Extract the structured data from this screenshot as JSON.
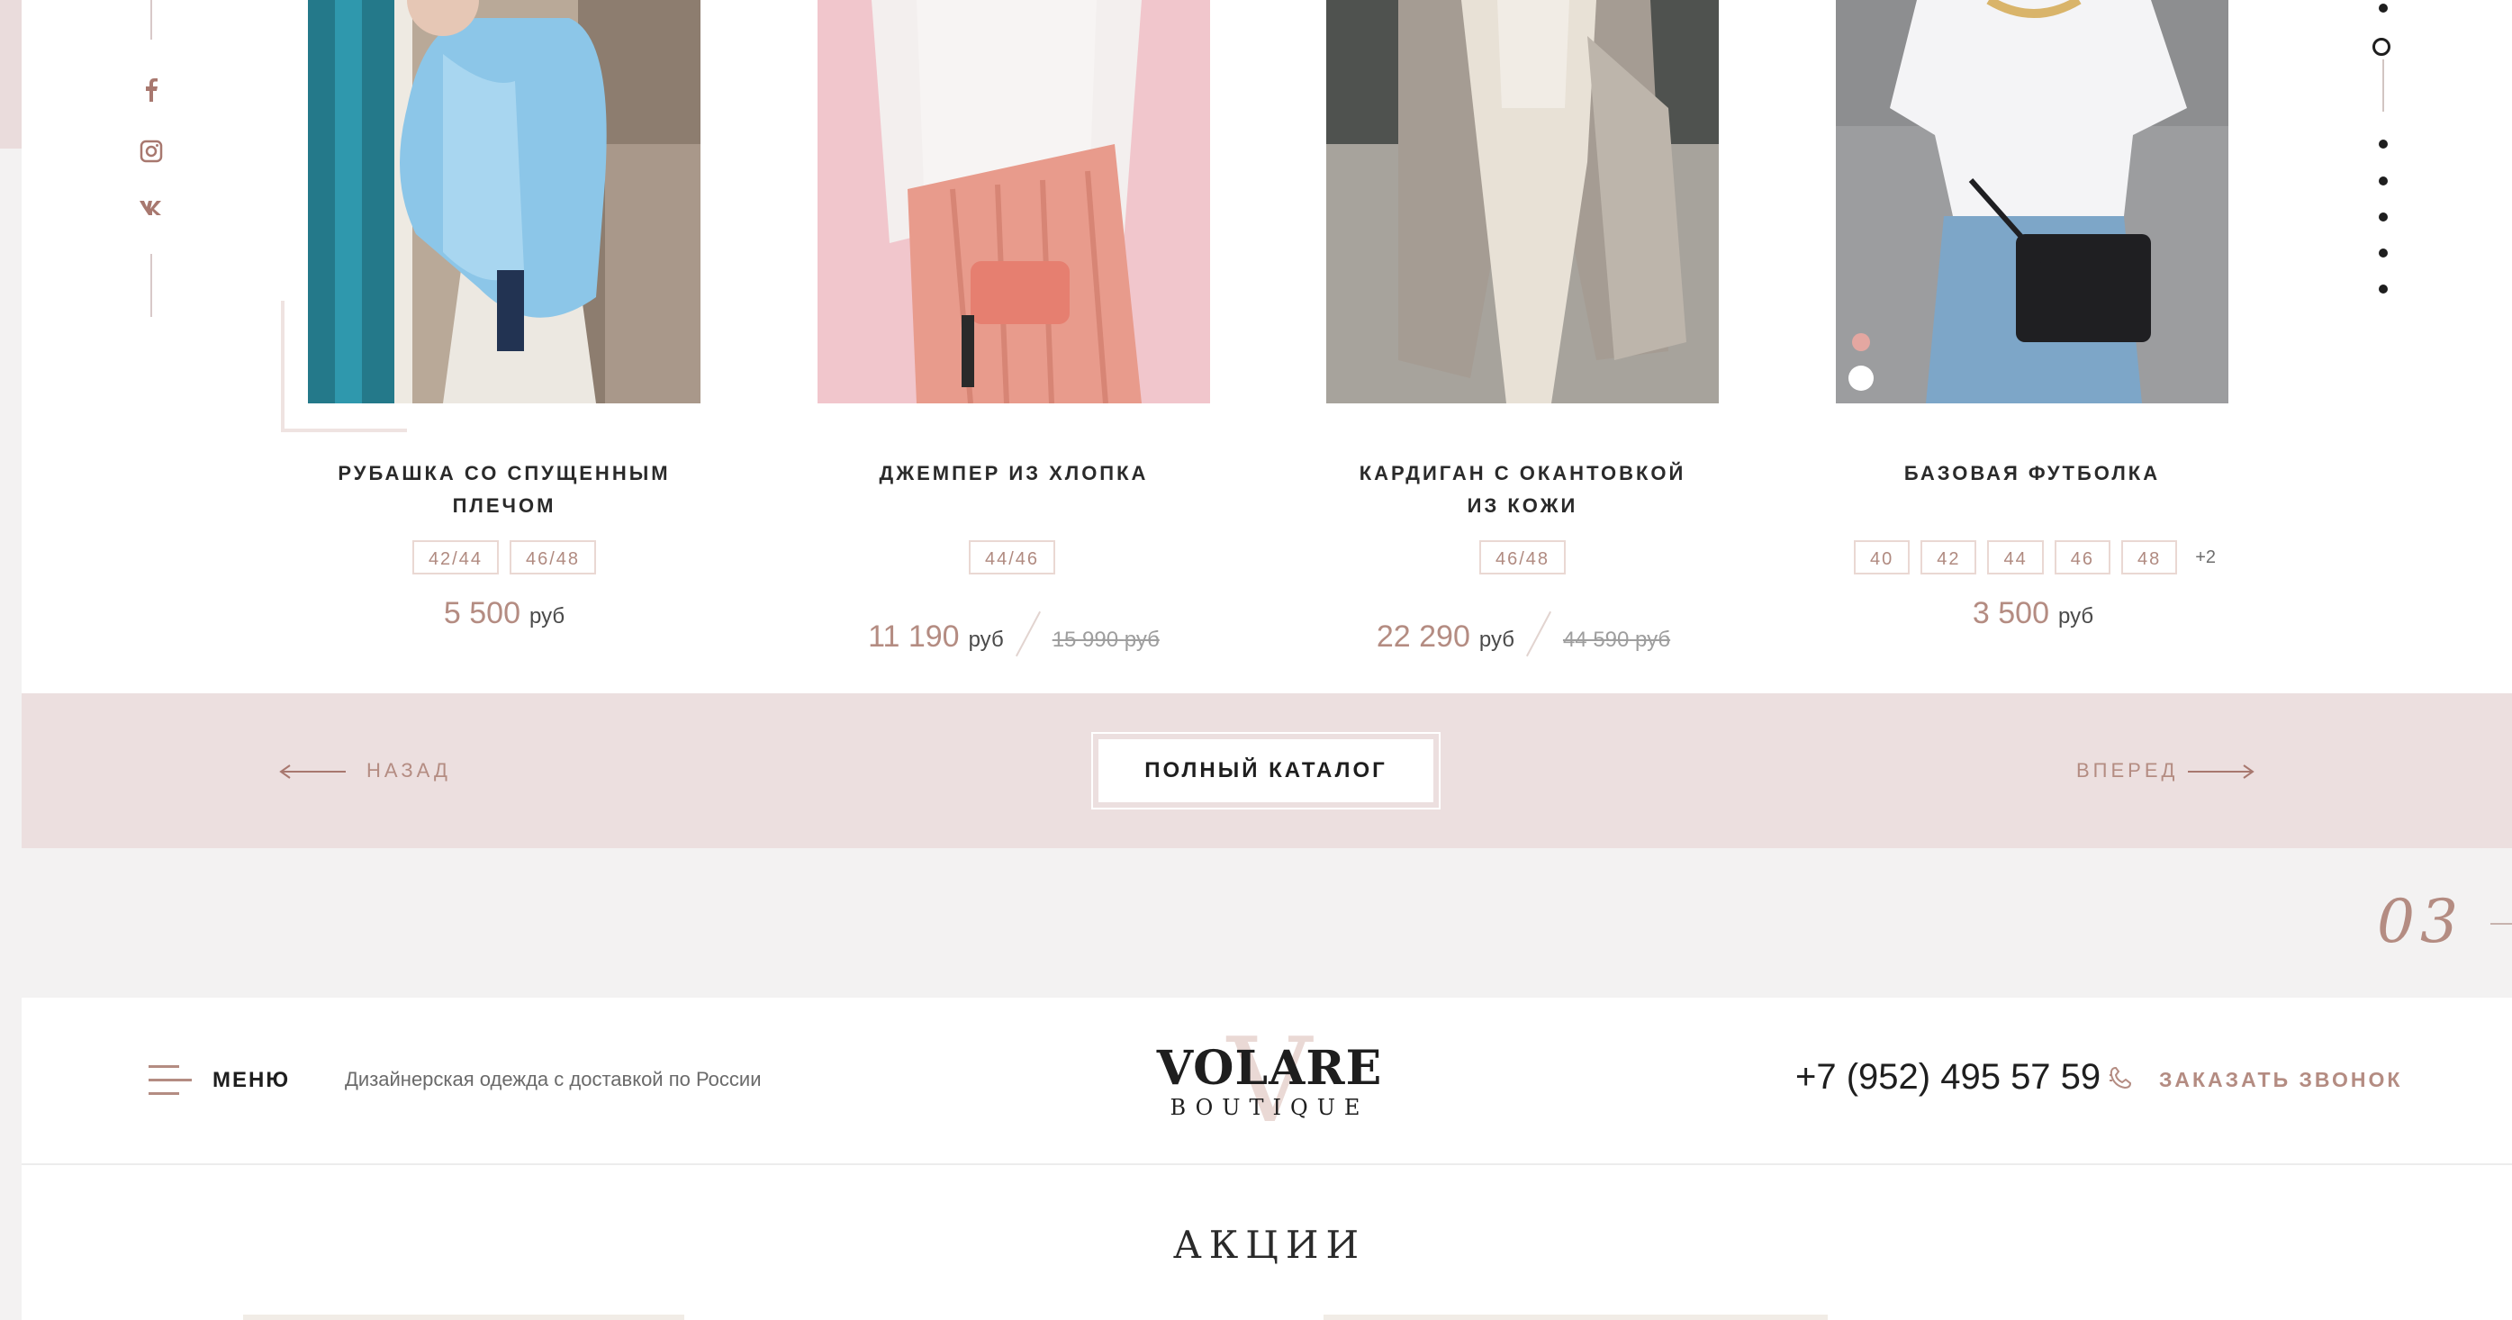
{
  "products": [
    {
      "title_line1": "Рубашка со спущенным",
      "title_line2": "плечом",
      "sizes": [
        "42/44",
        "46/48"
      ],
      "price": "5 500",
      "currency": "руб",
      "old_price": "",
      "old_currency": ""
    },
    {
      "title_line1": "Джемпер из хлопка",
      "title_line2": "",
      "sizes": [
        "44/46"
      ],
      "price": "11 190",
      "currency": "руб",
      "old_price": "15 990",
      "old_currency": "руб"
    },
    {
      "title_line1": "Кардиган с окантовкой",
      "title_line2": "из кожи",
      "sizes": [
        "46/48"
      ],
      "price": "22 290",
      "currency": "руб",
      "old_price": "44 590",
      "old_currency": "руб"
    },
    {
      "title_line1": "Базовая футболка",
      "title_line2": "",
      "sizes": [
        "40",
        "42",
        "44",
        "46",
        "48"
      ],
      "sizes_more": "+2",
      "price": "3 500",
      "currency": "руб",
      "old_price": "",
      "old_currency": ""
    }
  ],
  "social": {
    "icons": [
      "facebook-icon",
      "instagram-icon",
      "vk-icon"
    ],
    "labels": [
      "f",
      "◎",
      "vk"
    ]
  },
  "pagination": {
    "total_dots": 7,
    "active_index": 1
  },
  "nav": {
    "back_label": "Назад",
    "catalog_label": "ПОЛНЫЙ КАТАЛОГ",
    "forward_label": "Вперед"
  },
  "section_number": "03",
  "header": {
    "menu_label": "МЕНЮ",
    "tagline": "Дизайнерская одежда с доставкой по России",
    "logo_name": "VOLARE",
    "logo_sub": "BOUTIQUE",
    "logo_mark": "V",
    "phone": "+7 (952) 495 57 59",
    "call_label": "ЗАКАЗАТЬ ЗВОНОК"
  },
  "promotions": {
    "title": "АКЦИИ"
  },
  "colors": {
    "accent": "#b48c82",
    "pink_bar": "#ecdfdf",
    "text": "#1e1e1e"
  }
}
